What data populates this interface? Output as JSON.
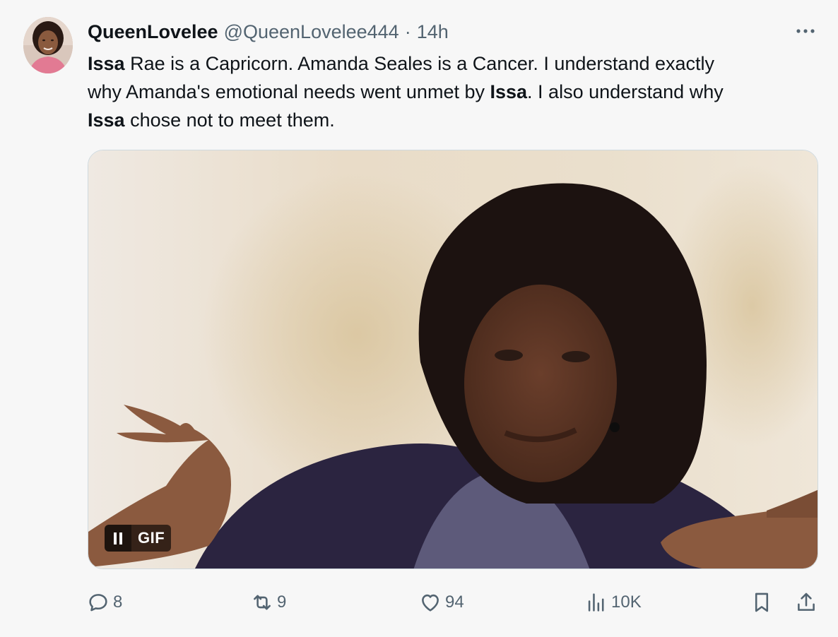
{
  "tweet": {
    "author": {
      "display_name": "QueenLovelee",
      "handle": "@QueenLovelee444",
      "separator": "·",
      "time": "14h"
    },
    "text_lines": [
      [
        {
          "t": "Issa",
          "bold": true
        },
        {
          "t": " Rae is a Capricorn. Amanda Seales is a Cancer. I understand exactly",
          "bold": false
        }
      ],
      [
        {
          "t": "why Amanda's emotional needs went unmet by ",
          "bold": false
        },
        {
          "t": "Issa",
          "bold": true
        },
        {
          "t": ". I also understand why",
          "bold": false
        }
      ],
      [
        {
          "t": "Issa",
          "bold": true
        },
        {
          "t": " chose not to meet them.",
          "bold": false
        }
      ]
    ],
    "media": {
      "type": "GIF",
      "badge_label": "GIF",
      "state": "playing"
    },
    "stats": {
      "replies": "8",
      "reposts": "9",
      "likes": "94",
      "views": "10K"
    },
    "icons": {
      "more": "more-icon",
      "reply": "reply-icon",
      "repost": "repost-icon",
      "like": "heart-icon",
      "views": "views-icon",
      "bookmark": "bookmark-icon",
      "share": "share-icon",
      "pause": "pause-icon"
    },
    "colors": {
      "text": "#0f1419",
      "secondary": "#536471",
      "background": "#f7f7f7"
    }
  }
}
